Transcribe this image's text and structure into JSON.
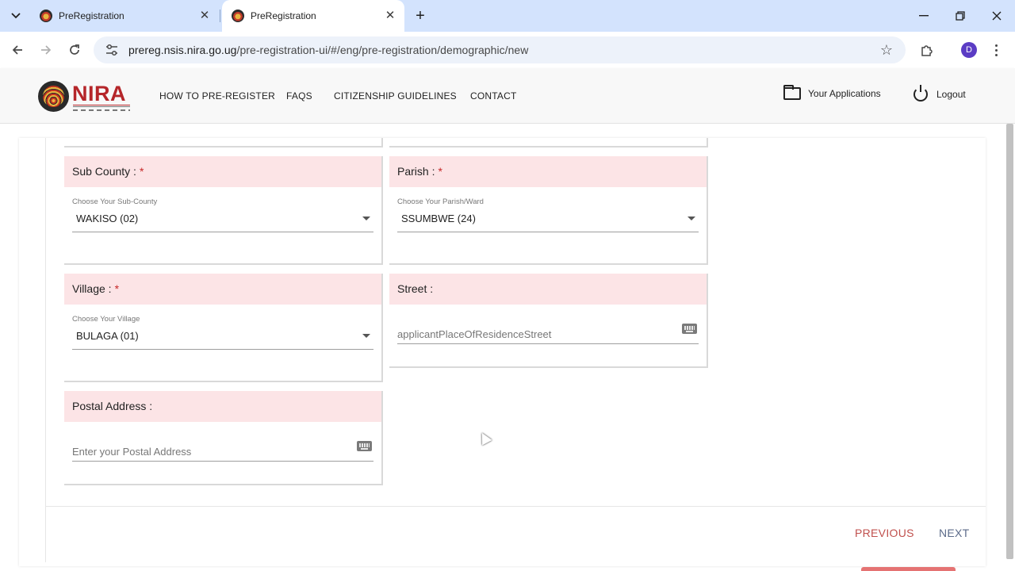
{
  "browser": {
    "tabs": [
      {
        "title": "PreRegistration",
        "active": false
      },
      {
        "title": "PreRegistration",
        "active": true
      }
    ],
    "url_host": "prereg.nsis.nira.go.ug",
    "url_path": "/pre-registration-ui/#/eng/pre-registration/demographic/new",
    "profile_initial": "D"
  },
  "header": {
    "logo_text": "NIRA",
    "nav": [
      "HOW TO PRE-REGISTER",
      "FAQS",
      "CITIZENSHIP GUIDELINES",
      "CONTACT"
    ],
    "your_applications": "Your Applications",
    "logout": "Logout"
  },
  "form": {
    "sub_county": {
      "label": "Sub County :",
      "required_mark": "*",
      "field_label": "Choose Your Sub-County",
      "value": "WAKISO (02)"
    },
    "parish": {
      "label": "Parish :",
      "required_mark": "*",
      "field_label": "Choose Your Parish/Ward",
      "value": "SSUMBWE (24)"
    },
    "village": {
      "label": "Village :",
      "required_mark": "*",
      "field_label": "Choose Your Village",
      "value": "BULAGA (01)"
    },
    "street": {
      "label": "Street :",
      "placeholder": "applicantPlaceOfResidenceStreet"
    },
    "postal_address": {
      "label": "Postal Address :",
      "placeholder": "Enter your Postal Address"
    }
  },
  "actions": {
    "previous": "PREVIOUS",
    "next": "NEXT"
  },
  "colors": {
    "field_header_bg": "#fce4e6",
    "required": "#c62828",
    "previous": "#c0504d",
    "next": "#5c6b8a",
    "brand": "#b5262a"
  }
}
